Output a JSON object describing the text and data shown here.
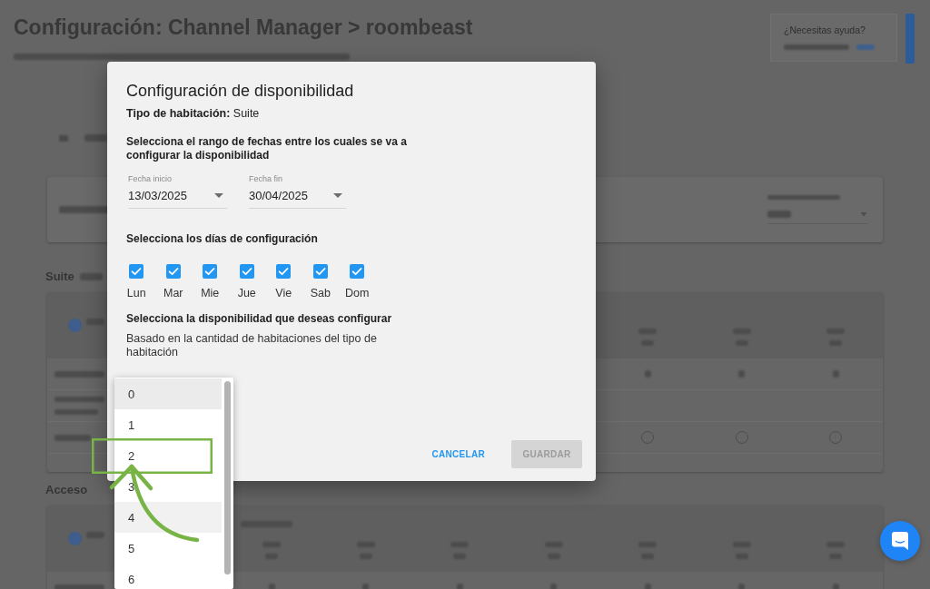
{
  "background": {
    "page_title": "Configuración: Channel Manager > roombeast",
    "help_card": {
      "title": "¿Necesitas ayuda?"
    },
    "sections": [
      {
        "title": "Suite"
      },
      {
        "title": "Acceso"
      }
    ]
  },
  "dialog": {
    "title": "Configuración de disponibilidad",
    "room_type": "**Tipo de habitación:** Suite",
    "date_range_heading": "Selecciona el rango de fechas entre los cuales se va a configurar la disponibilidad",
    "date_fields": [
      {
        "label": "Fecha inicio",
        "value": "13/03/2025"
      },
      {
        "label": "Fecha fin",
        "value": "30/04/2025"
      }
    ],
    "days_heading": "Selecciona los días de configuración",
    "days": [
      {
        "label": "Lun",
        "checked": true
      },
      {
        "label": "Mar",
        "checked": true
      },
      {
        "label": "Mie",
        "checked": true
      },
      {
        "label": "Jue",
        "checked": true
      },
      {
        "label": "Vie",
        "checked": true
      },
      {
        "label": "Sab",
        "checked": true
      },
      {
        "label": "Dom",
        "checked": true
      }
    ],
    "availability_heading": "Selecciona la disponibilidad que deseas configurar",
    "availability_hint": "Basado en la cantidad de habitaciones del tipo de habitación",
    "buttons": [
      {
        "label": "CANCELAR",
        "kind": "text",
        "disabled": false
      },
      {
        "label": "GUARDAR",
        "kind": "contained",
        "disabled": true
      }
    ]
  },
  "availability_menu": {
    "options": [
      {
        "label": "0",
        "selected": true,
        "hovered": false,
        "annotated": false
      },
      {
        "label": "1",
        "selected": false,
        "hovered": false,
        "annotated": false
      },
      {
        "label": "2",
        "selected": false,
        "hovered": false,
        "annotated": true
      },
      {
        "label": "3",
        "selected": false,
        "hovered": false,
        "annotated": false
      },
      {
        "label": "4",
        "selected": false,
        "hovered": true,
        "annotated": false
      },
      {
        "label": "5",
        "selected": false,
        "hovered": false,
        "annotated": false
      },
      {
        "label": "6",
        "selected": false,
        "hovered": false,
        "annotated": false
      }
    ]
  }
}
